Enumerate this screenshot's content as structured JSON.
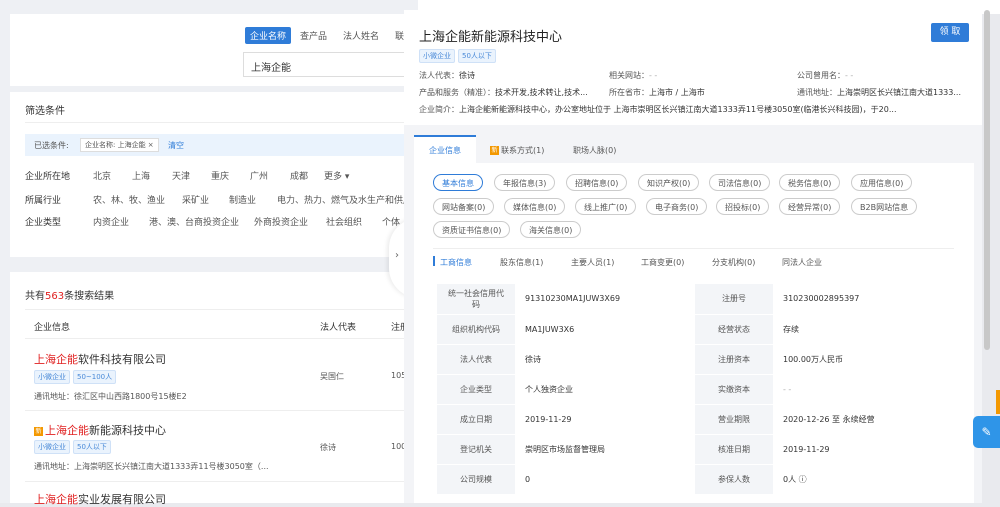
{
  "search": {
    "tabs": [
      "企业名称",
      "查产品",
      "法人姓名",
      "联"
    ],
    "query": "上海企能"
  },
  "filter": {
    "title": "筛选条件",
    "chosen_label": "已选条件:",
    "chosen_chip": "企业名称: 上海企能 ×",
    "clear": "清空",
    "rows": [
      {
        "label": "企业所在地",
        "options": [
          "北京",
          "上海",
          "天津",
          "重庆",
          "广州",
          "成都",
          "更多 ▾"
        ]
      },
      {
        "label": "所属行业",
        "options": [
          "农、林、牧、渔业",
          "采矿业",
          "制造业",
          "电力、热力、燃气及水生产和供应业"
        ]
      },
      {
        "label": "企业类型",
        "options": [
          "内资企业",
          "港、澳、台商投资企业",
          "外商投资企业",
          "社会组织",
          "个体"
        ]
      }
    ]
  },
  "results": {
    "count_prefix": "共有",
    "count": "563",
    "count_suffix": "条搜索结果",
    "col_company": "企业信息",
    "col_legal": "法人代表",
    "col_reg": "注册",
    "items": [
      {
        "hl": "上海企能",
        "rest": "软件科技有限公司",
        "tags": [
          "小微企业",
          "50~100人"
        ],
        "legal": "吴国仁",
        "reg": "105.",
        "addr": "通讯地址：徐汇区中山西路1800号15楼E2"
      },
      {
        "hl": "上海企能",
        "rest": "新能源科技中心",
        "tags": [
          "小微企业",
          "50人以下"
        ],
        "legal": "徐诗",
        "reg": "100.",
        "addr": "通讯地址：上海崇明区长兴镇江南大道1333弄11号楼3050室（..."
      },
      {
        "hl": "上海企能",
        "rest": "实业发展有限公司",
        "tags": [],
        "legal": "",
        "reg": "",
        "addr": ""
      }
    ]
  },
  "drawer": {
    "title": "上海企能新能源科技中心",
    "claim_button": "领 取",
    "tags": [
      "小微企业",
      "50人以下"
    ],
    "legal_label": "法人代表：",
    "legal_value": "徐诗",
    "website_label": "相关网站：",
    "website_value": "- -",
    "former_label": "公司曾用名：",
    "former_value": "- -",
    "products_label": "产品和服务（精准）：",
    "products_value": "技术开发,技术转让,技术...",
    "province_label": "所在省市：",
    "province_value": "上海市 / 上海市",
    "mail_label": "通讯地址：",
    "mail_value": "上海崇明区长兴镇江南大道1333...",
    "intro_label": "企业简介：",
    "intro_value": "上海企能新能源科技中心，办公室地址位于 上海市崇明区长兴镇江南大道1333弄11号楼3050室(临港长兴科技园)，于20...",
    "main_tabs": [
      "企业信息",
      "联系方式(1)",
      "职场人脉(0)"
    ],
    "info_buttons": [
      "基本信息",
      "年报信息(3)",
      "招聘信息(0)",
      "知识产权(0)",
      "司法信息(0)",
      "税务信息(0)",
      "应用信息(0)",
      "网站备案(0)",
      "媒体信息(0)",
      "线上推广(0)",
      "电子商务(0)",
      "招投标(0)",
      "经营异常(0)",
      "B2B网站信息",
      "资质证书信息(0)",
      "海关信息(0)"
    ],
    "sub_tabs": [
      "工商信息",
      "股东信息(1)",
      "主要人员(1)",
      "工商变更(0)",
      "分支机构(0)",
      "同法人企业"
    ],
    "table": [
      [
        "统一社会信用代码",
        "91310230MA1JUW3X69",
        "注册号",
        "310230002895397"
      ],
      [
        "组织机构代码",
        "MA1JUW3X6",
        "经营状态",
        "存续"
      ],
      [
        "法人代表",
        "徐诗",
        "注册资本",
        "100.00万人民币"
      ],
      [
        "企业类型",
        "个人独资企业",
        "实缴资本",
        "- -"
      ],
      [
        "成立日期",
        "2019-11-29",
        "营业期限",
        "2020-12-26 至 永续经营"
      ],
      [
        "登记机关",
        "崇明区市场监督管理局",
        "核准日期",
        "2019-11-29"
      ],
      [
        "公司规模",
        "0",
        "参保人数",
        "0人 ⓘ"
      ]
    ]
  },
  "colors": {
    "accent": "#2f7cd8",
    "highlight": "#e02020",
    "orange": "#f39800"
  }
}
